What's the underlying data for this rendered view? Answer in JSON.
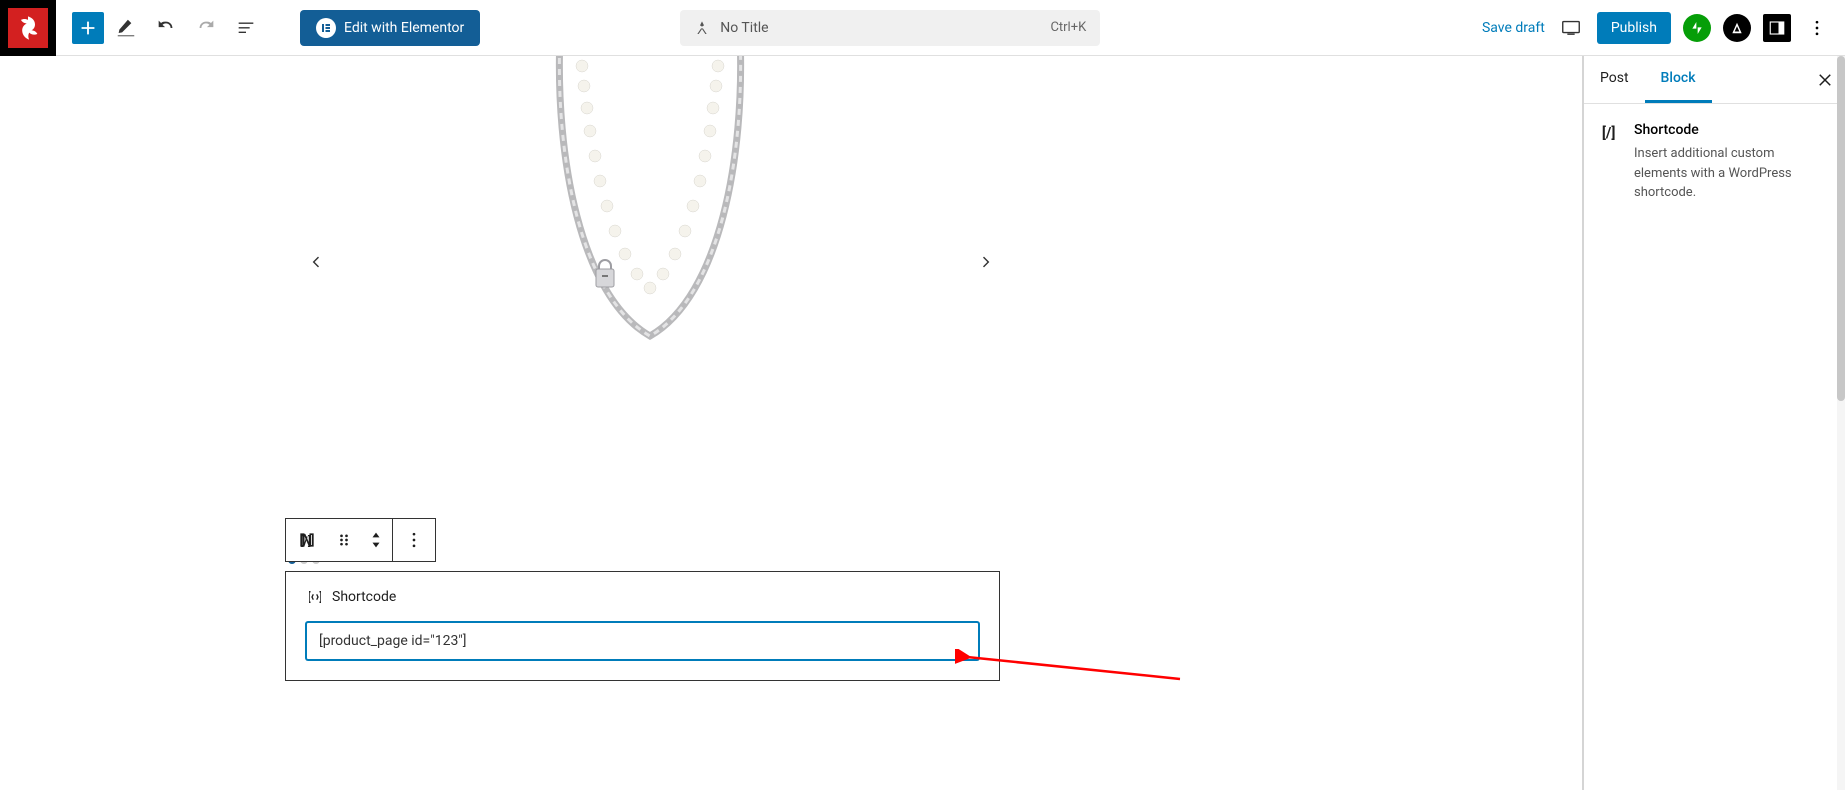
{
  "toolbar": {
    "elementor_label": "Edit with Elementor",
    "title": "No Title",
    "shortcut": "Ctrl+K",
    "save_draft": "Save draft",
    "publish": "Publish"
  },
  "carousel": {
    "dots_count": 3,
    "active_dot": 0
  },
  "block_toolbar": {
    "type": "shortcode"
  },
  "shortcode_block": {
    "label": "Shortcode",
    "value": "[product_page id=\"123\"]"
  },
  "sidebar": {
    "tabs": {
      "post": "Post",
      "block": "Block"
    },
    "title": "Shortcode",
    "description": "Insert additional custom elements with a WordPress shortcode."
  }
}
